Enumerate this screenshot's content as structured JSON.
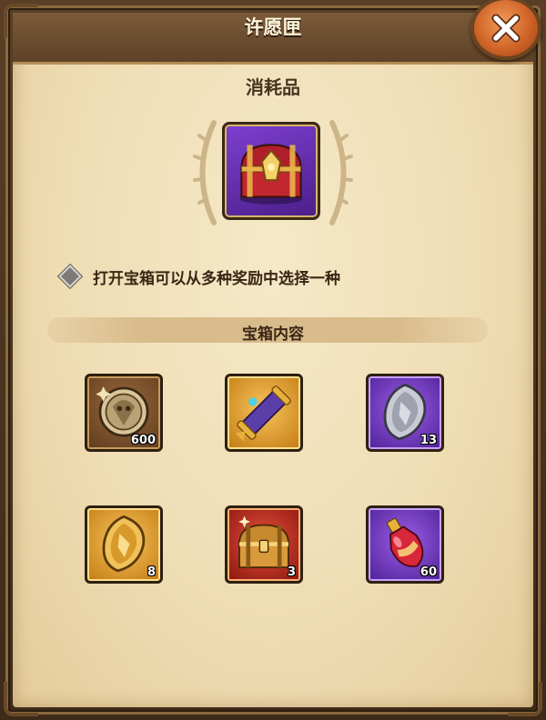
{
  "dialog": {
    "title": "许愿匣",
    "subtitle": "消耗品",
    "description": "打开宝箱可以从多种奖励中选择一种",
    "section_title": "宝箱内容"
  },
  "colors": {
    "title_text": "#fff5dc",
    "body_text": "#3a2614",
    "close_button": "#d06428",
    "purple_rarity": "#7d3fd0",
    "gold_rarity": "#f7c45a",
    "bronze_rarity": "#9a6a3c",
    "red_rarity": "#e6503c"
  },
  "items": [
    {
      "icon": "medallion-coin-icon",
      "rarity": "bronze",
      "count": "600"
    },
    {
      "icon": "scroll-icon",
      "rarity": "gold",
      "count": ""
    },
    {
      "icon": "silver-shard-icon",
      "rarity": "purple",
      "count": "13"
    },
    {
      "icon": "gold-shard-icon",
      "rarity": "gold",
      "count": "8"
    },
    {
      "icon": "treasure-chest-icon",
      "rarity": "red",
      "count": "3"
    },
    {
      "icon": "potion-icon",
      "rarity": "purple",
      "count": "60"
    }
  ]
}
